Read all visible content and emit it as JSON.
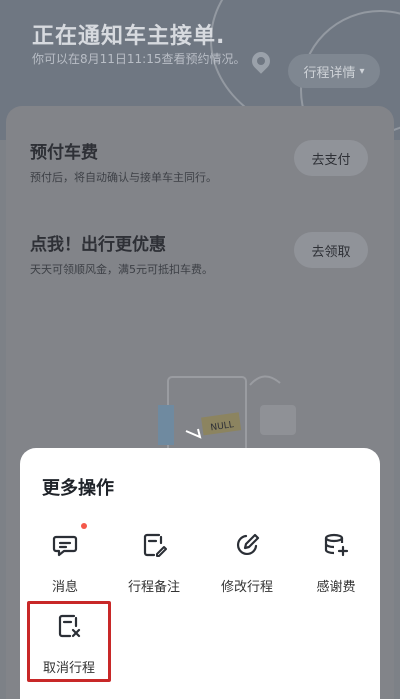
{
  "header": {
    "title": "正在通知车主接单.",
    "subtitle": "你可以在8月11日11:15查看预约情况。",
    "trip_detail_label": "行程详情"
  },
  "promos": [
    {
      "title": "预付车费",
      "subtitle": "预付后，将自动确认与接单车主同行。",
      "button": "去支付"
    },
    {
      "title": "点我！出行更优惠",
      "subtitle": "天天可领顺风金，满5元可抵扣车费。",
      "button": "去领取"
    }
  ],
  "illustration": {
    "tag_text": "NULL"
  },
  "sheet": {
    "title": "更多操作",
    "actions": [
      {
        "label": "消息",
        "icon": "message-icon",
        "badge": true
      },
      {
        "label": "行程备注",
        "icon": "note-edit-icon",
        "badge": false
      },
      {
        "label": "修改行程",
        "icon": "edit-trip-icon",
        "badge": false
      },
      {
        "label": "感谢费",
        "icon": "coins-add-icon",
        "badge": false
      },
      {
        "label": "取消行程",
        "icon": "cancel-trip-icon",
        "badge": false
      }
    ]
  },
  "colors": {
    "badge": "#f4584a",
    "highlight": "#c82828",
    "icon": "#2b2f36"
  }
}
